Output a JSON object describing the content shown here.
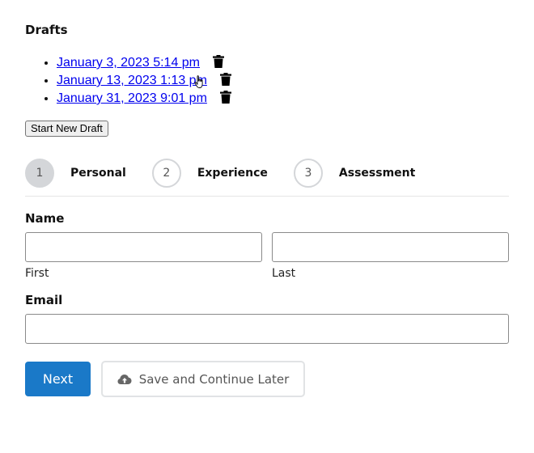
{
  "drafts": {
    "title": "Drafts",
    "items": [
      {
        "label": "January 3, 2023 5:14 pm"
      },
      {
        "label": "January 13, 2023 1:13 pm"
      },
      {
        "label": "January 31, 2023 9:01 pm"
      }
    ],
    "new_draft_label": "Start New Draft"
  },
  "steps": [
    {
      "number": "1",
      "label": "Personal",
      "active": true
    },
    {
      "number": "2",
      "label": "Experience",
      "active": false
    },
    {
      "number": "3",
      "label": "Assessment",
      "active": false
    }
  ],
  "form": {
    "name_label": "Name",
    "first_value": "",
    "first_sublabel": "First",
    "last_value": "",
    "last_sublabel": "Last",
    "email_label": "Email",
    "email_value": ""
  },
  "actions": {
    "next_label": "Next",
    "save_label": "Save and Continue Later"
  },
  "icons": {
    "trash": "trash-icon",
    "save": "cloud-upload-icon",
    "cursor": "hand-pointer-cursor"
  },
  "colors": {
    "link": "#0000ee",
    "primary": "#1a79c8",
    "step_active": "#d4d6d9"
  }
}
